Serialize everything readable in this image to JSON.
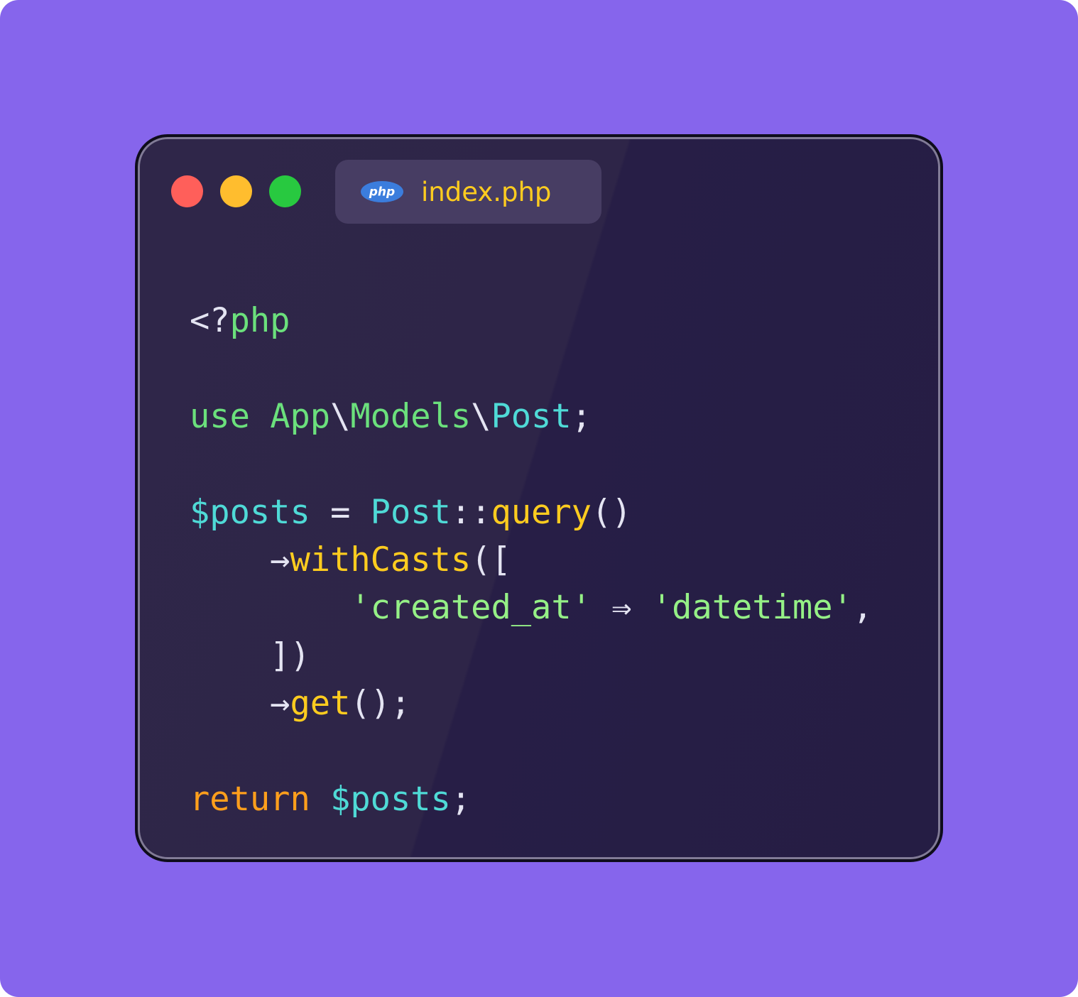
{
  "window": {
    "tab": {
      "icon": "php-logo-icon",
      "logo_text": "php",
      "title": "index.php"
    },
    "traffic_lights": [
      "close",
      "minimize",
      "maximize"
    ]
  },
  "colors": {
    "background": "#8665ec",
    "window": "#251d44",
    "tab": "#473d63",
    "close": "#ff5f5a",
    "minimize": "#ffbd2e",
    "maximize": "#28c940",
    "keyword_green": "#6be07c",
    "variable_teal": "#4fdad6",
    "function_yellow": "#ffcc1f",
    "string_green": "#95f086",
    "return_orange": "#ff9f1c"
  },
  "code": {
    "language": "php",
    "lines": [
      [
        {
          "t": "<?",
          "k": "punct"
        },
        {
          "t": "php",
          "k": "green"
        }
      ],
      [],
      [
        {
          "t": "use",
          "k": "green"
        },
        {
          "t": " ",
          "k": "punct"
        },
        {
          "t": "App",
          "k": "green"
        },
        {
          "t": "\\",
          "k": "punct"
        },
        {
          "t": "Models",
          "k": "green"
        },
        {
          "t": "\\",
          "k": "punct"
        },
        {
          "t": "Post",
          "k": "teal"
        },
        {
          "t": ";",
          "k": "punct"
        }
      ],
      [],
      [
        {
          "t": "$posts",
          "k": "teal"
        },
        {
          "t": " = ",
          "k": "punct"
        },
        {
          "t": "Post",
          "k": "teal"
        },
        {
          "t": "::",
          "k": "punct"
        },
        {
          "t": "query",
          "k": "yellow"
        },
        {
          "t": "()",
          "k": "punct"
        }
      ],
      [
        {
          "t": "    →",
          "k": "punct"
        },
        {
          "t": "withCasts",
          "k": "yellow"
        },
        {
          "t": "([",
          "k": "punct"
        }
      ],
      [
        {
          "t": "        ",
          "k": "punct"
        },
        {
          "t": "'created_at'",
          "k": "string"
        },
        {
          "t": " ⇒ ",
          "k": "punct"
        },
        {
          "t": "'datetime'",
          "k": "string"
        },
        {
          "t": ",",
          "k": "punct"
        }
      ],
      [
        {
          "t": "    ])",
          "k": "punct"
        }
      ],
      [
        {
          "t": "    →",
          "k": "punct"
        },
        {
          "t": "get",
          "k": "yellow"
        },
        {
          "t": "();",
          "k": "punct"
        }
      ],
      [],
      [
        {
          "t": "return",
          "k": "orange"
        },
        {
          "t": " ",
          "k": "punct"
        },
        {
          "t": "$posts",
          "k": "teal"
        },
        {
          "t": ";",
          "k": "punct"
        }
      ]
    ]
  }
}
